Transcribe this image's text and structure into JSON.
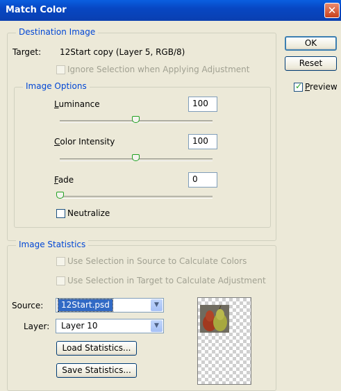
{
  "window": {
    "title": "Match Color",
    "close_glyph": "✕"
  },
  "destination": {
    "legend": "Destination Image",
    "target_label": "Target:",
    "target_value": "12Start copy (Layer 5, RGB/8)",
    "ignore_selection_label": "Ignore Selection when Applying Adjustment",
    "ignore_selection_checked": false
  },
  "image_options": {
    "legend": "Image Options",
    "luminance": {
      "label": "Luminance",
      "value": "100",
      "slider_fraction": 0.5
    },
    "color_intensity": {
      "label": "Color Intensity",
      "value": "100",
      "slider_fraction": 0.5
    },
    "fade": {
      "label": "Fade",
      "value": "0",
      "slider_fraction": 0.0
    },
    "neutralize_label": "Neutralize",
    "neutralize_checked": false
  },
  "buttons": {
    "ok": "OK",
    "reset": "Reset"
  },
  "preview": {
    "label": "Preview",
    "checked": true
  },
  "statistics": {
    "legend": "Image Statistics",
    "use_source_label": "Use Selection in Source to Calculate Colors",
    "use_target_label": "Use Selection in Target to Calculate Adjustment",
    "source_label": "Source:",
    "source_value": "12Start.psd",
    "layer_label": "Layer:",
    "layer_value": "Layer 10",
    "load_button": "Load Statistics...",
    "save_button": "Save Statistics..."
  },
  "icons": {
    "dropdown_arrow": "▼",
    "check": "✓"
  },
  "colors": {
    "title_bar": "#0747c3",
    "legend_text": "#0046d5",
    "dialog_bg": "#ece9d8",
    "selection": "#316ac5"
  }
}
